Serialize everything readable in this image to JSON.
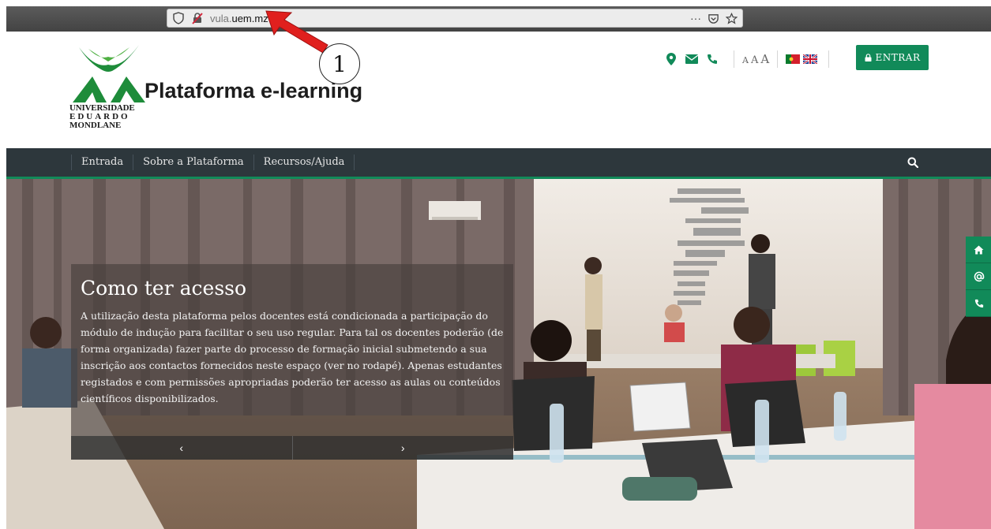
{
  "browser": {
    "url_prefix": "vula.",
    "url_domain": "uem.mz",
    "more_glyph": "···"
  },
  "annotation": {
    "marker_label": "1"
  },
  "header": {
    "uni_line1": "UNIVERSIDADE",
    "uni_line2": "EDUARDO",
    "uni_line3": "MONDLANE",
    "site_title": "Plataforma e-learning",
    "aaa": [
      "A",
      "A",
      "A"
    ],
    "login_label": "ENTRAR",
    "icons": [
      "map-marker-icon",
      "envelope-icon",
      "phone-icon"
    ]
  },
  "nav": {
    "items": [
      "Entrada",
      "Sobre a Plataforma",
      "Recursos/Ajuda"
    ]
  },
  "hero": {
    "title": "Como ter acesso",
    "text": "A utilização desta plataforma pelos docentes está condicionada a participação do módulo de indução para facilitar o seu uso regular. Para tal os docentes poderão (de forma organizada) fazer parte do processo de formação inicial submetendo a sua inscrição aos contactos fornecidos neste espaço (ver no rodapé). Apenas estudantes registados e com permissões apropriadas poderão ter acesso as aulas ou conteúdos científicos disponibilizados.",
    "prev_glyph": "‹",
    "next_glyph": "›"
  },
  "colors": {
    "brand_green": "#118a59",
    "navbar": "#2d373c"
  }
}
